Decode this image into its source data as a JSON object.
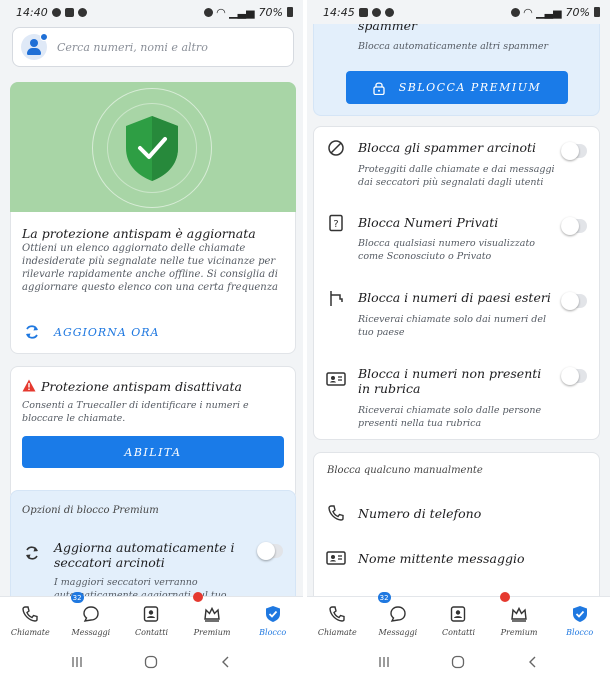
{
  "left": {
    "status": {
      "time": "14:40"
    },
    "search": {
      "placeholder": "Cerca numeri, nomi e altro"
    },
    "update_card": {
      "title": "La protezione antispam è aggiornata",
      "body": "Ottieni un elenco aggiornato delle chiamate indesiderate più segnalate nelle tue vicinanze per rilevarle rapidamente anche offline. Si consiglia di aggiornare questo elenco con una certa frequenza",
      "action": "AGGIORNA ORA"
    },
    "warning_card": {
      "title": "Protezione antispam disattivata",
      "body": "Consenti a Truecaller di identificare i numeri e bloccare le chiamate.",
      "button": "ABILITA"
    },
    "premium_card": {
      "header": "Opzioni di blocco Premium",
      "item_title": "Aggiorna automaticamente i seccatori arcinoti",
      "item_body": "I maggiori seccatori verranno automaticamente aggiornati sul tuo"
    }
  },
  "right": {
    "status": {
      "time": "14:45"
    },
    "top_card": {
      "partial_title": "spammer",
      "body": "Blocca automaticamente altri spammer",
      "button": "SBLOCCA PREMIUM"
    },
    "options": [
      {
        "title": "Blocca gli spammer arcinoti",
        "body": "Proteggiti dalle chiamate e dai messaggi dai seccatori più segnalati dagli utenti",
        "icon": "block-icon"
      },
      {
        "title": "Blocca Numeri Privati",
        "body": "Blocca qualsiasi numero visualizzato come Sconosciuto o Privato",
        "icon": "unknown-number-icon"
      },
      {
        "title": "Blocca i numeri di paesi esteri",
        "body": "Riceverai chiamate solo dai numeri del tuo paese",
        "icon": "flag-icon"
      },
      {
        "title": "Blocca i numeri non presenti in rubrica",
        "body": "Riceverai chiamate solo dalle persone presenti nella tua rubrica",
        "icon": "contact-card-icon"
      }
    ],
    "manual": {
      "header": "Blocca qualcuno manualmente",
      "items": [
        {
          "label": "Numero di telefono",
          "icon": "phone-icon"
        },
        {
          "label": "Nome mittente messaggio",
          "icon": "sender-icon"
        }
      ]
    }
  },
  "status_icons": {
    "battery": "70%"
  },
  "nav": {
    "items": [
      {
        "label": "Chiamate",
        "icon": "phone-icon"
      },
      {
        "label": "Messaggi",
        "icon": "message-icon",
        "badge": "32"
      },
      {
        "label": "Contatti",
        "icon": "contacts-icon"
      },
      {
        "label": "Premium",
        "icon": "crown-icon"
      },
      {
        "label": "Blocco",
        "icon": "shield-check-icon",
        "active": true
      }
    ]
  },
  "colors": {
    "accent": "#1a7be8",
    "hero_green": "#a8d5a6",
    "shield_green": "#2e9e44",
    "premium_bg": "#e3effb",
    "warning": "#e5392f"
  }
}
